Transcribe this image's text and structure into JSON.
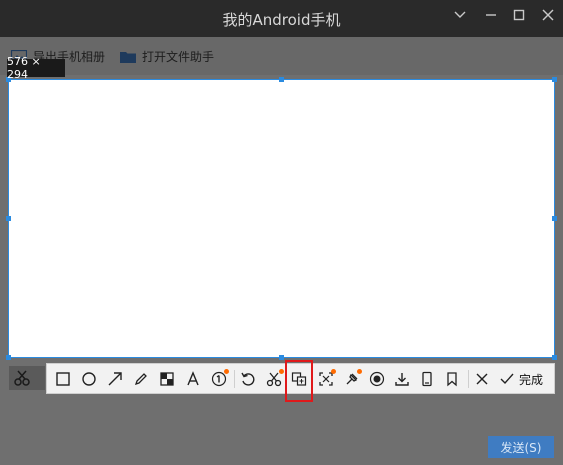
{
  "window": {
    "title": "我的Android手机",
    "controls": [
      "chevron-down-icon",
      "minimize-icon",
      "maximize-icon",
      "close-icon"
    ]
  },
  "actions": {
    "export_album": "导出手机相册",
    "file_helper": "打开文件助手"
  },
  "selection": {
    "size_label": "576 × 294"
  },
  "toolbar": {
    "tools": [
      "rectangle",
      "ellipse",
      "arrow",
      "pen",
      "mosaic",
      "text",
      "number",
      "undo",
      "pin",
      "translate",
      "ocr-scan",
      "screen-record",
      "target",
      "download",
      "long-screenshot",
      "bookmark",
      "cancel",
      "done"
    ],
    "done_label": "完成",
    "new_badge_color": "#ff6a00"
  },
  "send": {
    "label": "发送(S)"
  },
  "colors": {
    "accent": "#2b8be0",
    "highlight": "#e0191b",
    "send": "#3f7cc2"
  }
}
